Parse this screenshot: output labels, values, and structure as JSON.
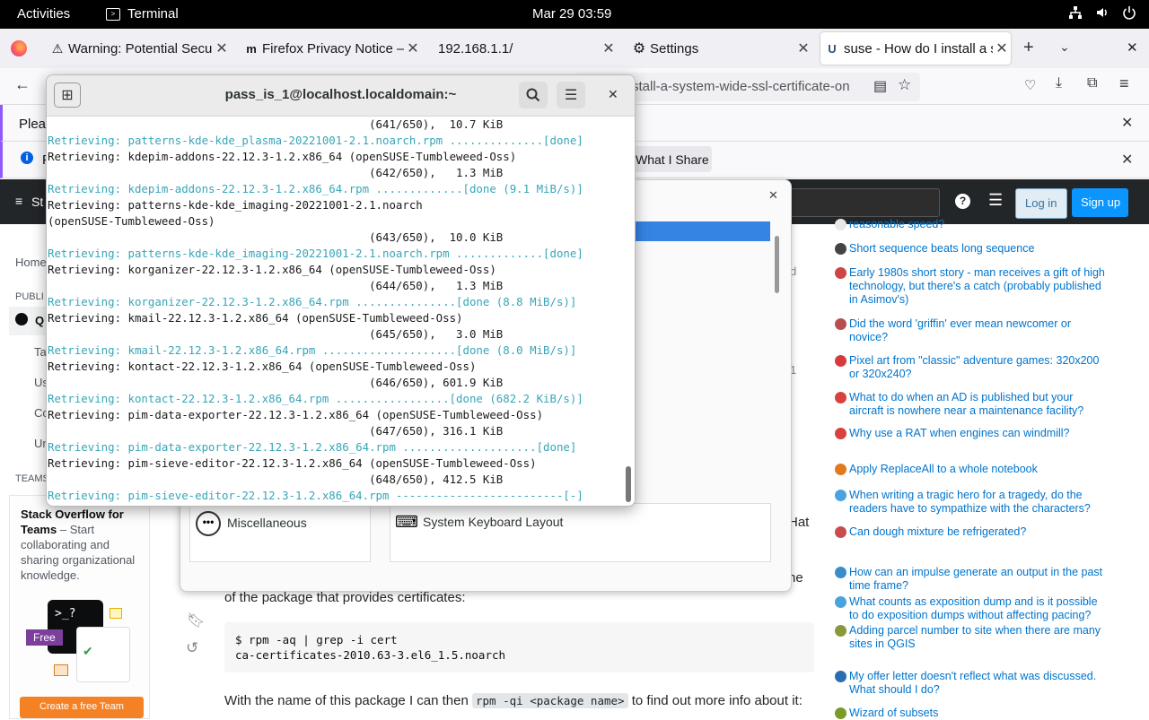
{
  "topbar": {
    "activities": "Activities",
    "app": "Terminal",
    "clock": "Mar 29  03:59"
  },
  "firefox": {
    "tabs": [
      {
        "label": "Warning: Potential Security Risk Ahead"
      },
      {
        "label": "Firefox Privacy Notice — Mozilla"
      },
      {
        "label": "192.168.1.1/"
      },
      {
        "label": "Settings"
      },
      {
        "label": "suse - How do I install a system-wide SSL certificate"
      }
    ],
    "url": "stall-a-system-wide-ssl-certificate-on",
    "notif1": "Pleas",
    "notif2": "P",
    "share_button": "What I Share"
  },
  "stackoverflow": {
    "logo": "St",
    "login": "Log in",
    "signup": "Sign up",
    "left_nav": {
      "home": "Home",
      "public": "PUBLI",
      "questions": "Q",
      "tags": "Ta",
      "users": "Us",
      "companies": "Co",
      "unanswered": "Un",
      "teams_header": "TEAMS",
      "teams_title": "Stack Overflow for Teams",
      "teams_dash": " – Start collaborating and sharing organizational knowledge.",
      "free_badge": "Free",
      "create_team": "Create a free Team",
      "prompt": ">_?"
    },
    "main": {
      "partial_right_1": "d",
      "partial_right_2": "1",
      "hat": "Hat",
      "ne": "ne",
      "text1": "of the package that provides certificates:",
      "code_line1": "$ rpm -aq | grep -i cert",
      "code_line2": "ca-certificates-2010.63-3.el6_1.5.noarch",
      "text2_a": "With the name of this package I can then ",
      "text2_code": "rpm -qi <package name>",
      "text2_b": " to find out more info about it:"
    },
    "hot_questions": [
      {
        "text": "reasonable speed?",
        "color": "#e8e8e8"
      },
      {
        "text": "Short sequence beats long sequence",
        "color": "#444444"
      },
      {
        "text": "Early 1980s short story - man receives a gift of high technology, but there's a catch (probably published in Asimov's)",
        "color": "#cf4545"
      },
      {
        "text": "Did the word 'griffin' ever mean newcomer or novice?",
        "color": "#b84f4f"
      },
      {
        "text": "Pixel art from \"classic\" adventure games: 320x200 or 320x240?",
        "color": "#d63b3b"
      },
      {
        "text": "What to do when an AD is published but your aircraft is nowhere near a maintenance facility?",
        "color": "#d94040"
      },
      {
        "text": "Why use a RAT when engines can windmill?",
        "color": "#d94040"
      },
      {
        "text": "Apply ReplaceAll to a whole notebook",
        "color": "#e07a1f"
      },
      {
        "text": "When writing a tragic hero for a tragedy, do the readers have to sympathize with the characters?",
        "color": "#4aa3df"
      },
      {
        "text": "Can dough mixture be refrigerated?",
        "color": "#c94c4c"
      },
      {
        "text": "How can an impulse generate an output in the past time frame?",
        "color": "#3a8dc9"
      },
      {
        "text": "What counts as exposition dump and is it possible to do exposition dumps without affecting pacing?",
        "color": "#4aa3df"
      },
      {
        "text": "Adding parcel number to site when there are many sites in QGIS",
        "color": "#8a9a3a"
      },
      {
        "text": "My offer letter doesn't reflect what was discussed. What should I do?",
        "color": "#2a6db3"
      },
      {
        "text": "Wizard of subsets",
        "color": "#7a9a2a"
      }
    ]
  },
  "settings": {
    "misc_label": "Miscellaneous",
    "keyboard_label": "System Keyboard Layout"
  },
  "terminal": {
    "title": "pass_is_1@localhost.localdomain:~",
    "lines": [
      {
        "t": "                                                (641/650),  10.7 KiB",
        "c": false
      },
      {
        "t": "Retrieving: patterns-kde-kde_plasma-20221001-2.1.noarch.rpm ..............[done]",
        "c": true
      },
      {
        "t": "Retrieving: kdepim-addons-22.12.3-1.2.x86_64 (openSUSE-Tumbleweed-Oss)",
        "c": false
      },
      {
        "t": "                                                (642/650),   1.3 MiB",
        "c": false
      },
      {
        "t": "Retrieving: kdepim-addons-22.12.3-1.2.x86_64.rpm .............[done (9.1 MiB/s)]",
        "c": true
      },
      {
        "t": "Retrieving: patterns-kde-kde_imaging-20221001-2.1.noarch",
        "c": false
      },
      {
        "t": "(openSUSE-Tumbleweed-Oss)",
        "c": false
      },
      {
        "t": "                                                (643/650),  10.0 KiB",
        "c": false
      },
      {
        "t": "Retrieving: patterns-kde-kde_imaging-20221001-2.1.noarch.rpm .............[done]",
        "c": true
      },
      {
        "t": "Retrieving: korganizer-22.12.3-1.2.x86_64 (openSUSE-Tumbleweed-Oss)",
        "c": false
      },
      {
        "t": "                                                (644/650),   1.3 MiB",
        "c": false
      },
      {
        "t": "Retrieving: korganizer-22.12.3-1.2.x86_64.rpm ...............[done (8.8 MiB/s)]",
        "c": true
      },
      {
        "t": "Retrieving: kmail-22.12.3-1.2.x86_64 (openSUSE-Tumbleweed-Oss)",
        "c": false
      },
      {
        "t": "                                                (645/650),   3.0 MiB",
        "c": false
      },
      {
        "t": "Retrieving: kmail-22.12.3-1.2.x86_64.rpm ....................[done (8.0 MiB/s)]",
        "c": true
      },
      {
        "t": "Retrieving: kontact-22.12.3-1.2.x86_64 (openSUSE-Tumbleweed-Oss)",
        "c": false
      },
      {
        "t": "                                                (646/650), 601.9 KiB",
        "c": false
      },
      {
        "t": "Retrieving: kontact-22.12.3-1.2.x86_64.rpm .................[done (682.2 KiB/s)]",
        "c": true
      },
      {
        "t": "Retrieving: pim-data-exporter-22.12.3-1.2.x86_64 (openSUSE-Tumbleweed-Oss)",
        "c": false
      },
      {
        "t": "                                                (647/650), 316.1 KiB",
        "c": false
      },
      {
        "t": "Retrieving: pim-data-exporter-22.12.3-1.2.x86_64.rpm ....................[done]",
        "c": true
      },
      {
        "t": "Retrieving: pim-sieve-editor-22.12.3-1.2.x86_64 (openSUSE-Tumbleweed-Oss)",
        "c": false
      },
      {
        "t": "                                                (648/650), 412.5 KiB",
        "c": false
      },
      {
        "t": "Retrieving: pim-sieve-editor-22.12.3-1.2.x86_64.rpm -------------------------[-]",
        "c": true
      }
    ]
  }
}
